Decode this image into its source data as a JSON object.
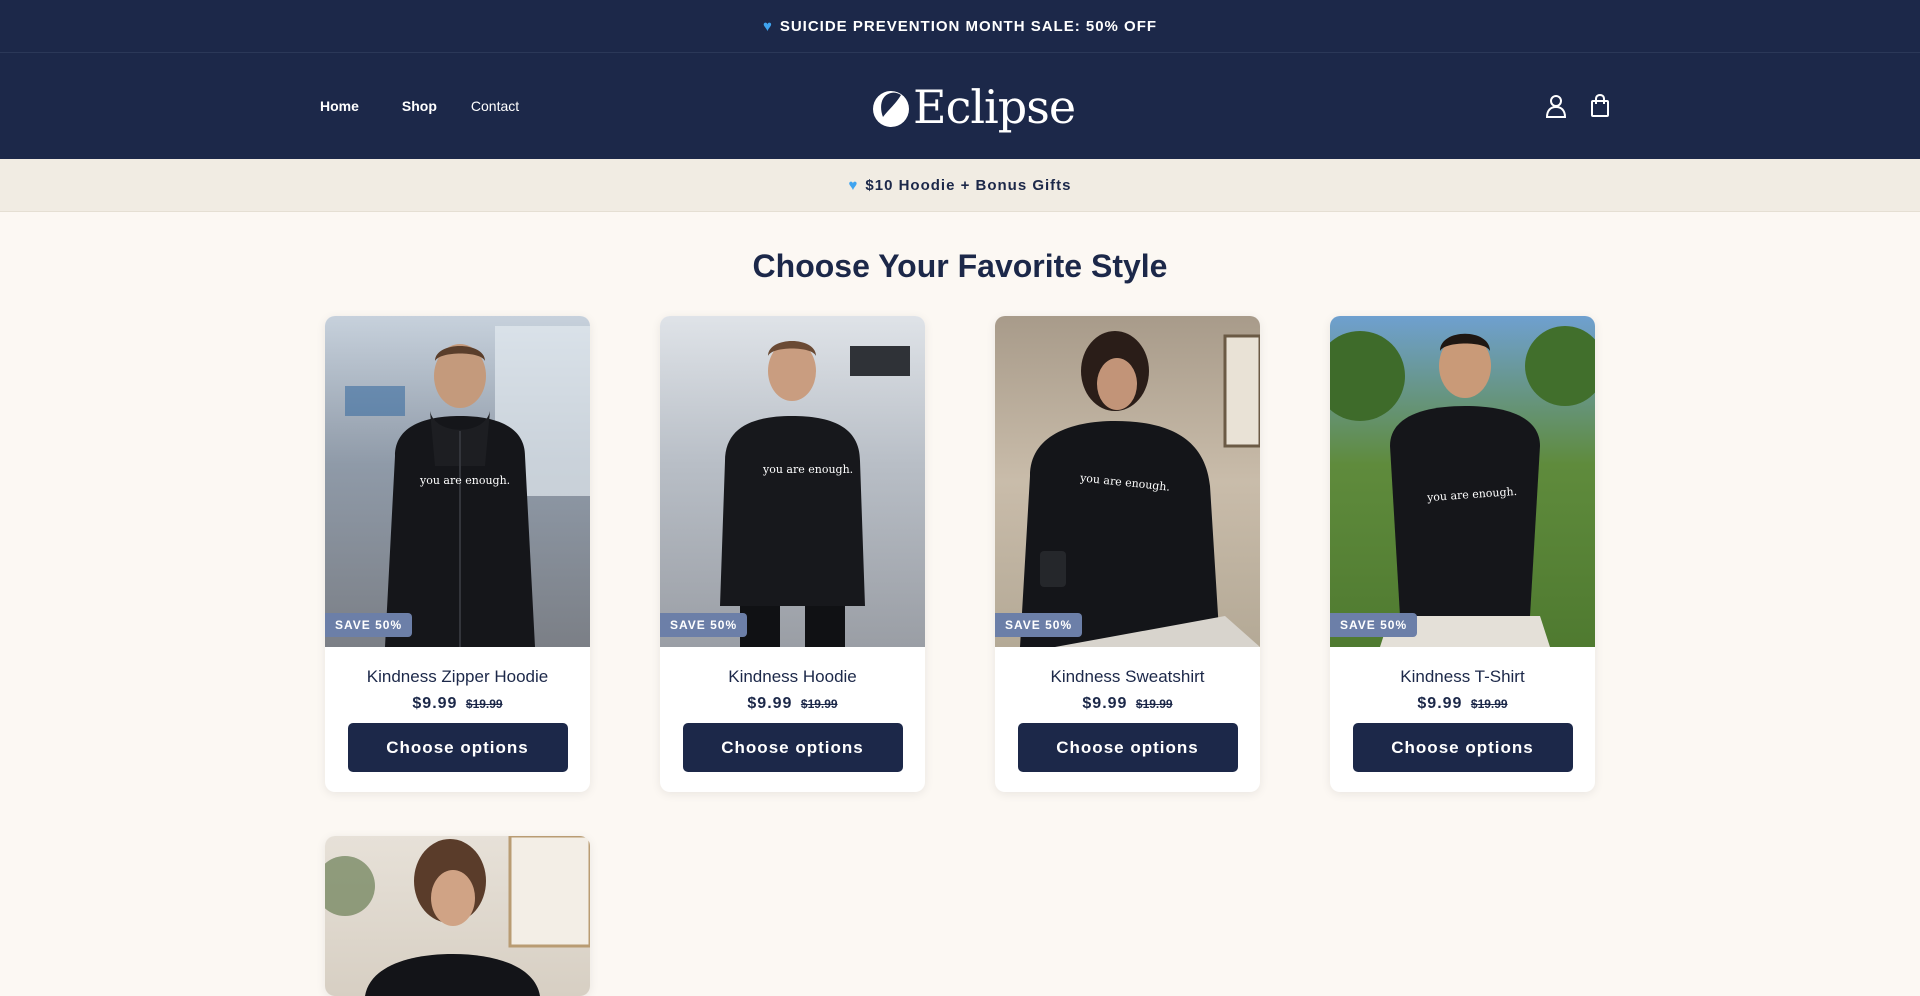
{
  "announcement": {
    "text": "SUICIDE PREVENTION MONTH SALE: 50% OFF",
    "icon": "blue-heart-icon"
  },
  "header": {
    "nav": [
      {
        "label": "Home"
      },
      {
        "label": "Shop"
      },
      {
        "label": "Contact"
      }
    ],
    "logo_text": "Eclipse",
    "icons": [
      "account-icon",
      "cart-icon"
    ]
  },
  "promo": {
    "text": "$10 Hoodie + Bonus Gifts",
    "icon": "blue-heart-icon"
  },
  "section": {
    "title": "Choose Your Favorite Style"
  },
  "products": [
    {
      "name": "Kindness Zipper Hoodie",
      "price": "$9.99",
      "compare": "$19.99",
      "badge": "SAVE 50%",
      "button": "Choose options",
      "print": "you are enough."
    },
    {
      "name": "Kindness Hoodie",
      "price": "$9.99",
      "compare": "$19.99",
      "badge": "SAVE 50%",
      "button": "Choose options",
      "print": "you are enough."
    },
    {
      "name": "Kindness Sweatshirt",
      "price": "$9.99",
      "compare": "$19.99",
      "badge": "SAVE 50%",
      "button": "Choose options",
      "print": "you are enough."
    },
    {
      "name": "Kindness T-Shirt",
      "price": "$9.99",
      "compare": "$19.99",
      "badge": "SAVE 50%",
      "button": "Choose options",
      "print": "you are enough."
    }
  ],
  "colors": {
    "navy": "#1c2849",
    "cream": "#fcf8f3",
    "badge": "#6c7fa8",
    "heart": "#3fa4f0"
  }
}
